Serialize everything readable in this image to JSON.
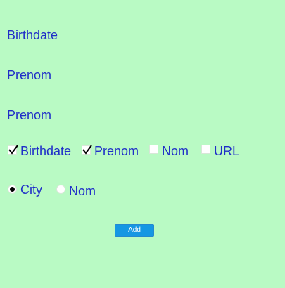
{
  "form": {
    "fields": [
      {
        "label": "Birthdate",
        "value": ""
      },
      {
        "label": "Prenom",
        "value": ""
      },
      {
        "label": "Prenom",
        "value": ""
      }
    ],
    "checkboxes": [
      {
        "label": "Birthdate",
        "checked": true
      },
      {
        "label": "Prenom",
        "checked": true
      },
      {
        "label": "Nom",
        "checked": false
      },
      {
        "label": "URL",
        "checked": false
      }
    ],
    "radios": [
      {
        "label": "City",
        "selected": true
      },
      {
        "label": "Nom",
        "selected": false
      }
    ],
    "submit_label": "Add"
  },
  "colors": {
    "background": "#b9fac4",
    "text": "#1f2ec8",
    "button": "#1597e3"
  }
}
